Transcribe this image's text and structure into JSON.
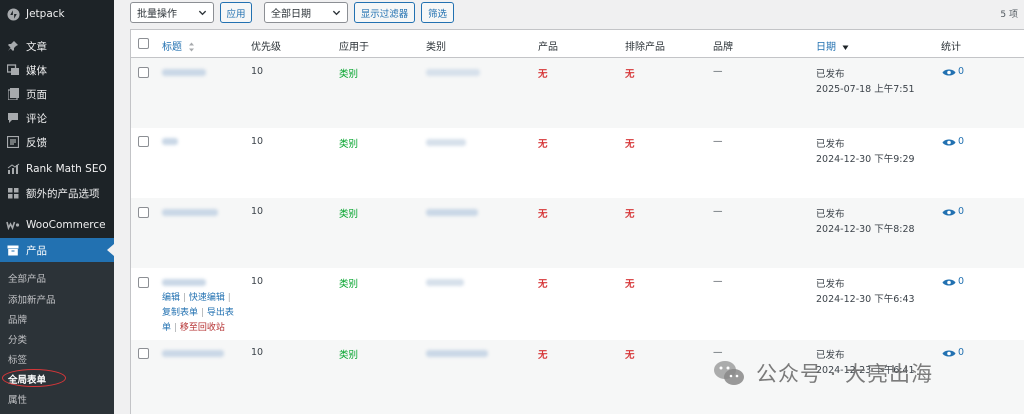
{
  "sidebar": {
    "items": [
      {
        "id": "jetpack",
        "label": "Jetpack",
        "icon": "jetpack-icon"
      },
      {
        "id": "posts",
        "label": "文章",
        "icon": "pin-icon"
      },
      {
        "id": "media",
        "label": "媒体",
        "icon": "media-icon"
      },
      {
        "id": "pages",
        "label": "页面",
        "icon": "page-icon"
      },
      {
        "id": "comments",
        "label": "评论",
        "icon": "comment-icon"
      },
      {
        "id": "feedback",
        "label": "反馈",
        "icon": "feedback-icon"
      },
      {
        "id": "rankmath",
        "label": "Rank Math SEO",
        "icon": "rankmath-icon"
      },
      {
        "id": "extra",
        "label": "额外的产品选项",
        "icon": "grid-icon"
      },
      {
        "id": "woo",
        "label": "WooCommerce",
        "icon": "woo-icon"
      },
      {
        "id": "products",
        "label": "产品",
        "icon": "box-icon"
      }
    ],
    "submenu": [
      {
        "label": "全部产品"
      },
      {
        "label": "添加新产品"
      },
      {
        "label": "品牌"
      },
      {
        "label": "分类"
      },
      {
        "label": "标签"
      },
      {
        "label": "全局表单"
      },
      {
        "label": "属性"
      }
    ]
  },
  "toolbar": {
    "bulk_action": "批量操作",
    "apply": "应用",
    "date_filter": "全部日期",
    "show_filter": "显示过滤器",
    "filter": "筛选",
    "count": "5 项"
  },
  "table": {
    "headers": {
      "title": "标题",
      "priority": "优先级",
      "apply_to": "应用于",
      "category": "类别",
      "product": "产品",
      "exclude": "排除产品",
      "brand": "品牌",
      "date": "日期",
      "stats": "统计"
    },
    "rows": [
      {
        "priority": "10",
        "apply": "类别",
        "product": "无",
        "exclude": "无",
        "brand": "—",
        "status": "已发布",
        "date": "2025-07-18 上午7:51",
        "stats": "0"
      },
      {
        "priority": "10",
        "apply": "类别",
        "product": "无",
        "exclude": "无",
        "brand": "—",
        "status": "已发布",
        "date": "2024-12-30 下午9:29",
        "stats": "0"
      },
      {
        "priority": "10",
        "apply": "类别",
        "product": "无",
        "exclude": "无",
        "brand": "—",
        "status": "已发布",
        "date": "2024-12-30 下午8:28",
        "stats": "0"
      },
      {
        "priority": "10",
        "apply": "类别",
        "product": "无",
        "exclude": "无",
        "brand": "—",
        "status": "已发布",
        "date": "2024-12-30 下午6:43",
        "stats": "0"
      },
      {
        "priority": "10",
        "apply": "类别",
        "product": "无",
        "exclude": "无",
        "brand": "—",
        "status": "已发布",
        "date": "2024-12-23 下午6:41",
        "stats": "0"
      }
    ],
    "row_actions": {
      "edit": "编辑",
      "quick_edit": "快速编辑",
      "copy_form_a": "复制表单",
      "export_a": "导出表",
      "export_b": "单",
      "trash": "移至回收站",
      "sep": "|"
    }
  },
  "watermark": {
    "text": "公众号 · 大亮出海"
  },
  "colors": {
    "accent": "#2271b1",
    "sidebar": "#1d2327",
    "green": "#00a32a",
    "red": "#d63638"
  }
}
